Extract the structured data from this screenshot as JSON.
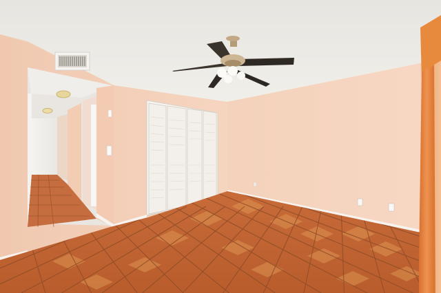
{
  "scene": {
    "colors": {
      "ceiling": "#ecebe6",
      "left_wall": "#f2cdb6",
      "right_wall": "#f6d3bd",
      "closet": "#f6f3ee",
      "floor_tile": "#c9703c",
      "floor_tile_light": "#dd9450",
      "grout": "#8b4a26",
      "baseboard": "#f7f3ee",
      "curtain": "#e2823c",
      "hallway_wall": "#f0efec"
    },
    "icons": [
      "ceiling-fan-icon",
      "light-fixture-icon",
      "air-vent-icon",
      "electrical-outlet-icon",
      "light-switch-icon"
    ]
  }
}
